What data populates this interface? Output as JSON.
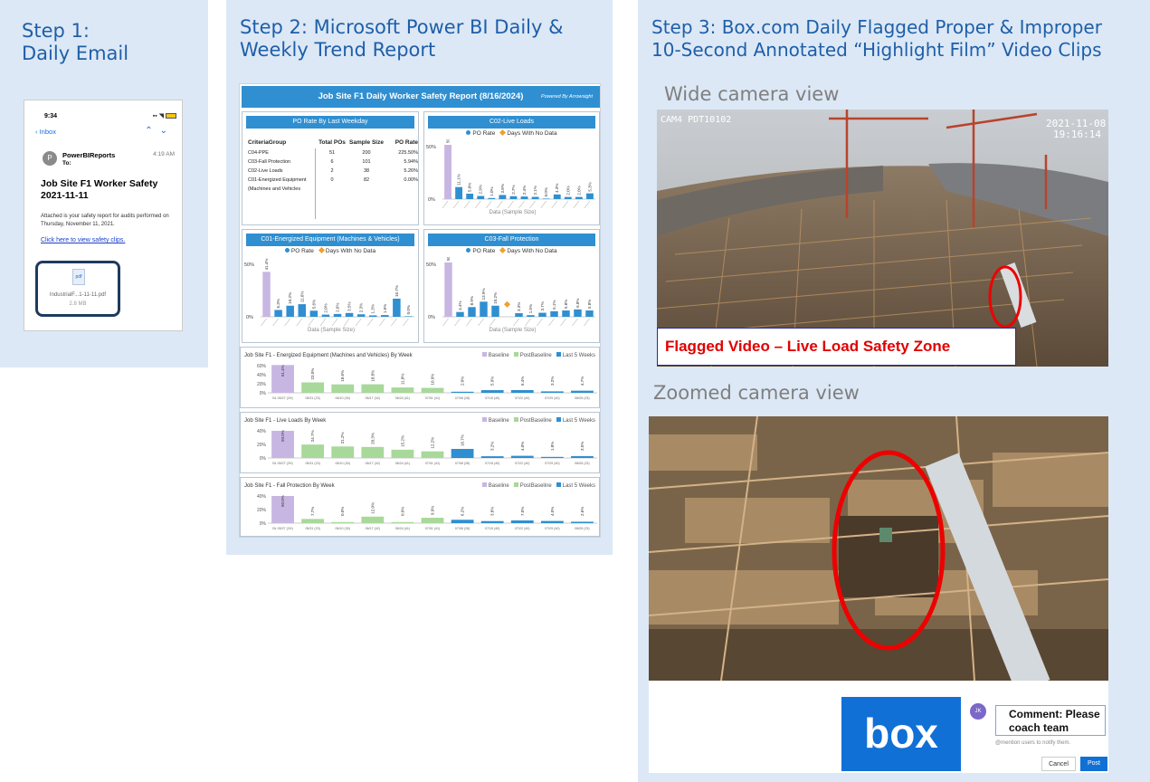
{
  "steps": {
    "step1_title_line1": "Step   1:",
    "step1_title_line2": "Daily Email",
    "step2_title_line1": "Step 2: Microsoft Power BI Daily &",
    "step2_title_line2": "Weekly Trend Report",
    "step3_title_line1": "Step 3: Box.com Daily Flagged Proper & Improper",
    "step3_title_line2": "10-Second Annotated “Highlight Film” Video Clips"
  },
  "email": {
    "time": "9:34",
    "back_label": "Inbox",
    "sender": "PowerBIReports",
    "to_label": "To:",
    "received_time": "4:19 AM",
    "avatar_letter": "P",
    "subject_line1": "Job Site F1 Worker Safety",
    "subject_line2": "2021-11-11",
    "body": "Attached is your safety report for audits performed on Thursday, November 11, 2021.",
    "link": "Click here to view safety clips.",
    "attachment_type": "pdf",
    "attachment_name": "IndustrialF...1-11-11.pdf",
    "attachment_size": "2.8 MB"
  },
  "report": {
    "title": "Job Site F1 Daily Worker Safety Report (8/16/2024)",
    "powered_by": "Powered By Arrowsight",
    "legend_rate": "PO Rate",
    "legend_nodata": "Days With No Data",
    "x_axis_label": "Data (Sample Size)",
    "table_card": {
      "title": "PO Rate By Last Weekday",
      "headers": [
        "CriteriaGroup",
        "Total POs",
        "Sample Size",
        "PO Rate"
      ],
      "rows": [
        [
          "C04-PPE",
          "51",
          "200",
          "225.50%"
        ],
        [
          "C03-Fall Protection",
          "6",
          "101",
          "5.94%"
        ],
        [
          "C02-Live Loads",
          "2",
          "38",
          "5.26%"
        ],
        [
          "C01-Energized Equipment",
          "0",
          "82",
          "0.00%"
        ],
        [
          "(Machines and Vehicles",
          "",
          "",
          ""
        ]
      ]
    },
    "daily_charts": [
      {
        "title": "C02-Live Loads",
        "ytop": "50%",
        "ybottom": "0%",
        "values": [
          50.0,
          11.1,
          5.0,
          2.9,
          1.0,
          3.8,
          2.7,
          2.4,
          2.1,
          0.0,
          4.3,
          2.0,
          2.0,
          5.3
        ],
        "labels": [
          "50.0%",
          "11.1%",
          "5.0%",
          "2.9%",
          "1.0%",
          "3.8%",
          "2.7%",
          "2.4%",
          "2.1%",
          "0.0%",
          "4.3%",
          "2.0%",
          "2.0%",
          "5.3%"
        ]
      },
      {
        "title": "C01-Energized Equipment (Machines & Vehicles)",
        "ytop": "50%",
        "ybottom": "0%",
        "values": [
          41.4,
          6.3,
          10.2,
          11.6,
          5.6,
          2.0,
          2.6,
          3.5,
          2.3,
          1.3,
          1.6,
          16.7,
          0.0
        ],
        "labels": [
          "41.4%",
          "6.3%",
          "10.2%",
          "11.6%",
          "5.6%",
          "2.0%",
          "2.6%",
          "3.5%",
          "2.3%",
          "1.3%",
          "1.6%",
          "16.7%",
          "0.0%"
        ]
      },
      {
        "title": "C03-Fall Protection",
        "ytop": "50%",
        "ybottom": "0%",
        "values": [
          50.0,
          4.4,
          8.9,
          13.9,
          10.2,
          0,
          3.3,
          1.5,
          3.7,
          5.1,
          5.8,
          6.8,
          5.8
        ],
        "labels": [
          "50.0%",
          "4.4%",
          "8.9%",
          "13.9%",
          "10.2%",
          "",
          "3.3%",
          "1.5%",
          "3.7%",
          "5.1%",
          "5.8%",
          "6.8%",
          "5.8%"
        ],
        "nodata_index": 5
      }
    ],
    "weekly_legend": [
      "Baseline",
      "PostBaseline",
      "Last 5 Weeks"
    ],
    "weekly_colors": {
      "baseline": "#c8b6e2",
      "postbaseline": "#a8d89a",
      "last5": "#2f8fd1"
    },
    "weekly_charts": [
      {
        "title": "Job Site F1 - Energized Equipment (Machines and Vehicles) By Week",
        "yticks": [
          "60%",
          "40%",
          "20%",
          "0%"
        ],
        "ymax": 60,
        "values": [
          61.4,
          23.0,
          18.6,
          18.8,
          11.8,
          10.9,
          2.0,
          5.9,
          6.4,
          3.2,
          4.7
        ],
        "labels": [
          "61.4%",
          "23.0%",
          "18.6%",
          "18.8%",
          "11.8%",
          "10.9%",
          "2.0%",
          "5.9%",
          "6.4%",
          "3.2%",
          "4.7%"
        ],
        "xlabels": [
          "BL 05/27 (2H)",
          "05/31 (23)",
          "06/10 (30)",
          "06/17 (42)",
          "06/24 (41)",
          "07/01 (41)",
          "07/08 (28)",
          "07/15 (40)",
          "07/22 (40)",
          "07/29 (40)",
          "08/05 (23)"
        ]
      },
      {
        "title": "Job Site F1 - Live Loads By Week",
        "yticks": [
          "40%",
          "20%",
          "0%"
        ],
        "ymax": 50,
        "values": [
          50.0,
          24.7,
          21.2,
          20.3,
          15.2,
          12.2,
          16.7,
          3.2,
          4.0,
          1.8,
          3.5
        ],
        "labels": [
          "50.0%",
          "24.7%",
          "21.2%",
          "20.3%",
          "15.2%",
          "12.2%",
          "16.7%",
          "3.2%",
          "4.0%",
          "1.8%",
          "3.5%"
        ],
        "xlabels": [
          "BL 05/27 (2H)",
          "05/31 (23)",
          "06/10 (30)",
          "06/17 (42)",
          "06/24 (41)",
          "07/01 (41)",
          "07/08 (28)",
          "07/15 (40)",
          "07/22 (40)",
          "07/29 (40)",
          "08/05 (23)"
        ]
      },
      {
        "title": "Job Site F1 - Fall Protection By Week",
        "yticks": [
          "40%",
          "20%",
          "0%"
        ],
        "ymax": 50,
        "values": [
          50.0,
          7.7,
          0.0,
          12.0,
          0.0,
          9.9,
          6.2,
          3.8,
          7.0,
          4.0,
          2.6
        ],
        "labels": [
          "50.0%",
          "7.7%",
          "0.0%",
          "12.0%",
          "0.0%",
          "9.9%",
          "6.2%",
          "3.8%",
          "7.0%",
          "4.0%",
          "2.6%"
        ],
        "xlabels": [
          "BL 05/27 (2H)",
          "05/31 (23)",
          "06/10 (30)",
          "06/17 (42)",
          "06/24 (41)",
          "07/01 (41)",
          "07/08 (28)",
          "07/15 (40)",
          "07/22 (40)",
          "07/29 (40)",
          "08/05 (23)"
        ]
      }
    ]
  },
  "video": {
    "wide_label": "Wide camera view",
    "zoom_label": "Zoomed camera view",
    "cam_id": "CAM4 PDT10102",
    "timestamp_date": "2021-11-08",
    "timestamp_time": "19:16:14",
    "flag_text": "Flagged Video –  Live Load Safety Zone"
  },
  "box": {
    "logo": "box",
    "avatar_initials": "JK",
    "comment_line1": "Comment: Please",
    "comment_line2": "coach team",
    "mention_hint": "@mention users to notify them.",
    "cancel_label": "Cancel",
    "post_label": "Post"
  }
}
